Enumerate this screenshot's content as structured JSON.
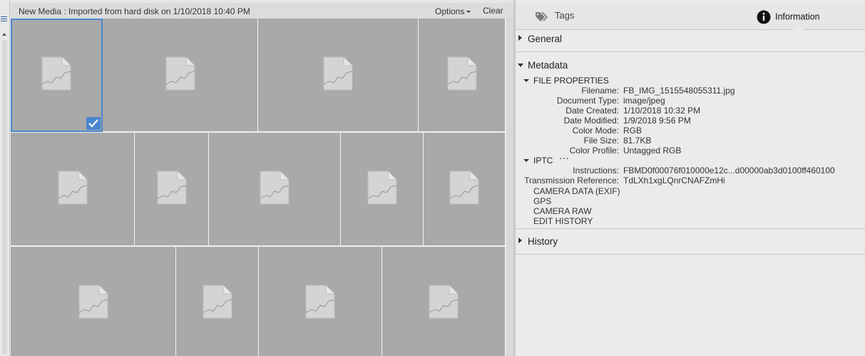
{
  "media": {
    "title": "New Media : Imported from hard disk on 1/10/2018 10:40 PM",
    "options_label": "Options",
    "clear_label": "Clear"
  },
  "panel": {
    "tabs": {
      "tags": "Tags",
      "information": "Information"
    },
    "sections": {
      "general": "General",
      "metadata": "Metadata",
      "history": "History"
    },
    "file_properties": {
      "title": "FILE PROPERTIES",
      "rows": [
        {
          "key": "Filename:",
          "value": "FB_IMG_1515548055311.jpg"
        },
        {
          "key": "Document Type:",
          "value": "image/jpeg"
        },
        {
          "key": "Date Created:",
          "value": "1/10/2018 10:32 PM"
        },
        {
          "key": "Date Modified:",
          "value": "1/9/2018 9:56 PM"
        },
        {
          "key": "Color Mode:",
          "value": "RGB"
        },
        {
          "key": "File Size:",
          "value": "81.7KB"
        },
        {
          "key": "Color Profile:",
          "value": "Untagged RGB"
        }
      ]
    },
    "iptc": {
      "title": "IPTC",
      "more": "···",
      "rows": [
        {
          "key": "Instructions:",
          "value": "FBMD0f00076f010000e12c...d00000ab3d0100ff460100"
        },
        {
          "key": "Transmission Reference:",
          "value": "TdLXh1xgLQnrCNAFZmHi"
        }
      ]
    },
    "other_groups": [
      "CAMERA DATA (EXIF)",
      "GPS",
      "CAMERA RAW",
      "EDIT HISTORY"
    ]
  },
  "colors": {
    "tile_bg": "#a9a9a9",
    "selection": "#4a86d0",
    "panel_bg": "#ebebeb"
  },
  "icons": {
    "thumbnail": "broken-file-icon",
    "tags_tab": "tag-icon",
    "info_tab": "info-icon",
    "selected": "checkmark-icon"
  }
}
